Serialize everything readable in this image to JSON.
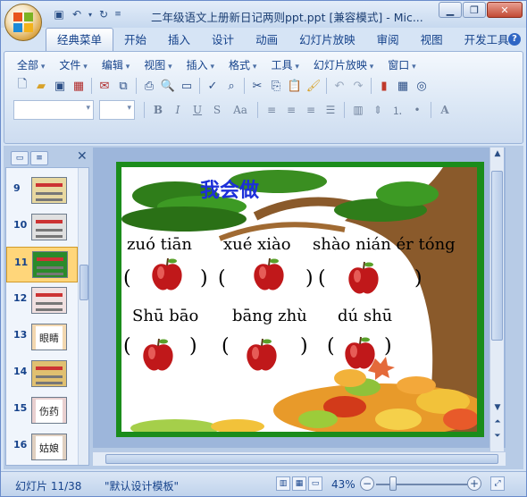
{
  "window": {
    "title": "二年级语文上册新日记两则ppt.ppt [兼容模式] - Mic..."
  },
  "ribbon_tabs": [
    "经典菜单",
    "开始",
    "插入",
    "设计",
    "动画",
    "幻灯片放映",
    "审阅",
    "视图",
    "开发工具"
  ],
  "active_tab": "经典菜单",
  "classic_menu": [
    "全部",
    "文件",
    "编辑",
    "视图",
    "插入",
    "格式",
    "工具",
    "幻灯片放映",
    "窗口"
  ],
  "format_buttons": [
    "B",
    "I",
    "U",
    "S",
    "Aa"
  ],
  "thumbnails": [
    {
      "num": "9"
    },
    {
      "num": "10"
    },
    {
      "num": "11",
      "selected": true
    },
    {
      "num": "12"
    },
    {
      "num": "13",
      "text": "眼睛"
    },
    {
      "num": "14"
    },
    {
      "num": "15",
      "text": "伤药"
    },
    {
      "num": "16",
      "text": "姑娘"
    }
  ],
  "slide": {
    "title": "我会做",
    "row1": [
      "zuó tiān",
      "xué xiào",
      "shào nián ér tóng"
    ],
    "row2": [
      "Shū bāo",
      "bāng zhù",
      "dú  shū"
    ],
    "paren_open": "(",
    "paren_close": ")"
  },
  "status": {
    "slide_info": "幻灯片 11/38",
    "template": "\"默认设计模板\"",
    "zoom": "43%",
    "zoom_level_percent": 43
  },
  "colors": {
    "title_blue": "#1c2fd9",
    "slide_border": "#1b8c1b",
    "apple_red": "#c0181a",
    "selected_thumb": "#ffd67a"
  }
}
